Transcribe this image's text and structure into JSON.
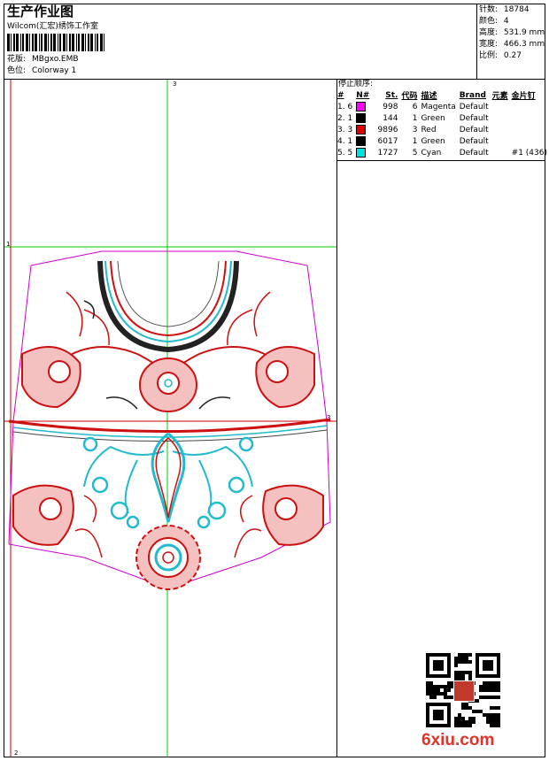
{
  "header": {
    "title": "生产作业图",
    "company": "Wilcom(汇宏)绣饰工作室",
    "design_label": "花版:",
    "design_value": "MBgxo.EMB",
    "colorway_label": "色位:",
    "colorway_value": "Colorway 1"
  },
  "specs": [
    {
      "label": "针数:",
      "value": "18784"
    },
    {
      "label": "颜色:",
      "value": "4"
    },
    {
      "label": "高度:",
      "value": "531.9 mm"
    },
    {
      "label": "宽度:",
      "value": "466.3 mm"
    },
    {
      "label": "比例:",
      "value": "0.27"
    }
  ],
  "stops": {
    "title": "停止顺序:",
    "headers": [
      "#",
      "N#",
      "St.",
      "代码",
      "描述",
      "Brand",
      "元素",
      "金片钉"
    ],
    "rows": [
      {
        "idx": "1. 6",
        "color": "#ff00ff",
        "stitches": "998",
        "code": "6",
        "desc": "Magenta",
        "brand": "Default",
        "element": "",
        "sequin": ""
      },
      {
        "idx": "2. 1",
        "color": "#000000",
        "stitches": "144",
        "code": "1",
        "desc": "Green",
        "brand": "Default",
        "element": "",
        "sequin": ""
      },
      {
        "idx": "3. 3",
        "color": "#e00000",
        "stitches": "9896",
        "code": "3",
        "desc": "Red",
        "brand": "Default",
        "element": "",
        "sequin": ""
      },
      {
        "idx": "4. 1",
        "color": "#000000",
        "stitches": "6017",
        "code": "1",
        "desc": "Green",
        "brand": "Default",
        "element": "",
        "sequin": ""
      },
      {
        "idx": "5. 5",
        "color": "#00e0e0",
        "stitches": "1727",
        "code": "5",
        "desc": "Cyan",
        "brand": "Default",
        "element": "",
        "sequin": "#1 (436)"
      }
    ]
  },
  "guides": {
    "top": "3",
    "left": "1",
    "right": "3",
    "bottom": "2"
  },
  "watermark": "6xiu.com",
  "colors": {
    "guide_green": "#00cc00",
    "guide_red": "#cc0000",
    "outline": "#cc00cc",
    "thread_red": "#cc1111",
    "thread_cyan": "#22bbcc"
  }
}
